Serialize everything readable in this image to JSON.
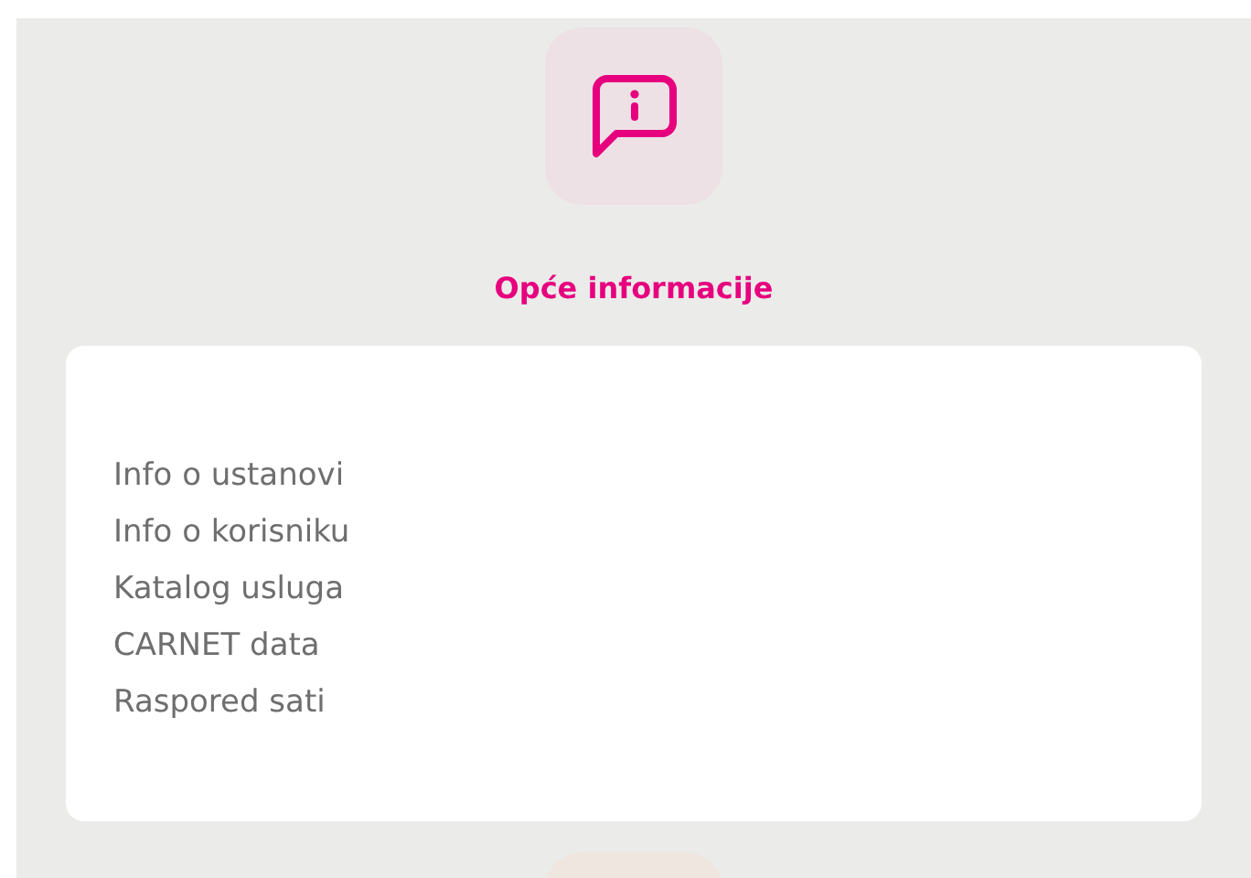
{
  "section": {
    "title": "Opće informacije"
  },
  "links": [
    {
      "label": "Info o ustanovi"
    },
    {
      "label": "Info o korisniku"
    },
    {
      "label": "Katalog usluga"
    },
    {
      "label": "CARNET data"
    },
    {
      "label": "Raspored sati"
    }
  ]
}
